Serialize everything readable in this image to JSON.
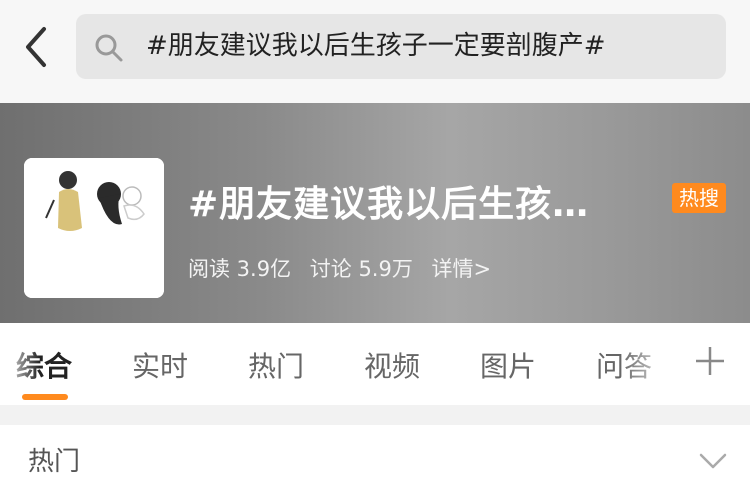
{
  "search": {
    "query": "#朋友建议我以后生孩子一定要剖腹产#"
  },
  "topic": {
    "title": "#朋友建议我以后生孩…",
    "badge": "热搜",
    "reads": "阅读 3.9亿",
    "discussions": "讨论 5.9万",
    "details": "详情>"
  },
  "tabs": [
    {
      "label": "综合",
      "active": true
    },
    {
      "label": "实时"
    },
    {
      "label": "热门"
    },
    {
      "label": "视频"
    },
    {
      "label": "图片"
    },
    {
      "label": "问答"
    }
  ],
  "section": {
    "label": "热门"
  },
  "colors": {
    "accent": "#ff8a1e",
    "banner": "#8a8a8a",
    "search_bg": "#e6e6e6"
  },
  "icons": [
    "back-arrow-icon",
    "search-icon",
    "plus-icon",
    "chevron-down-icon"
  ]
}
